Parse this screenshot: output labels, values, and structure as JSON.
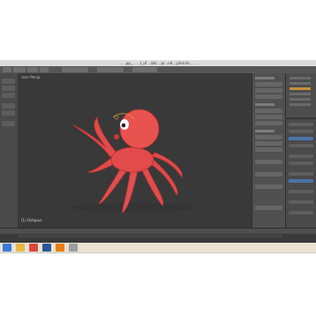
{
  "window": {
    "title": "... ..pp_... ...t_of ...blo ...pr...nd ...plne.bl... ..."
  },
  "viewport": {
    "view_label": "User Persp",
    "object_label": "(1) Octopus"
  },
  "timeline": {
    "status_text": ""
  },
  "taskbar": {
    "apps": [
      "start",
      "explorer",
      "chrome",
      "word",
      "blender",
      "file"
    ],
    "clock_time": "",
    "clock_date": ""
  },
  "colors": {
    "octopus": "#e24b4b",
    "octopus_shade": "#b83232",
    "viewport_bg": "#393939",
    "selection_outline": "#e6a43a",
    "taskbar_bg": "#e9e2d2"
  }
}
